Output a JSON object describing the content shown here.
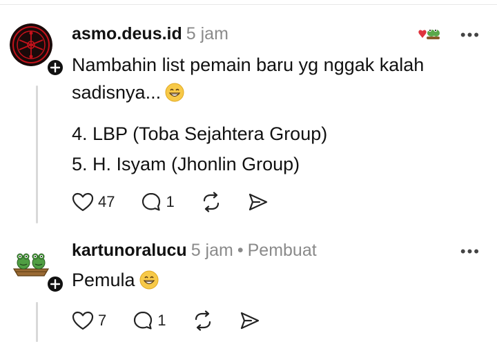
{
  "posts": [
    {
      "username": "asmo.deus.id",
      "time": "5 jam",
      "text": "Nambahin list pemain baru yg nggak kalah sadisnya...",
      "list": [
        "4. LBP (Toba Sejahtera Group)",
        "5. H. Isyam (Jhonlin Group)"
      ],
      "likes": "47",
      "replies": "1",
      "avatar_icon": "occult-seal-avatar",
      "reaction_icon": "heart-frogs-icon"
    },
    {
      "username": "kartunoralucu",
      "time": "5 jam",
      "role": "Pembuat",
      "text": "Pemula",
      "likes": "7",
      "replies": "1",
      "avatar_icon": "frogs-boat-avatar"
    }
  ],
  "colors": {
    "text": "#111111",
    "muted": "#8a8a8a",
    "thread_line": "#d9d9d9",
    "seal_red": "#c4121b"
  }
}
